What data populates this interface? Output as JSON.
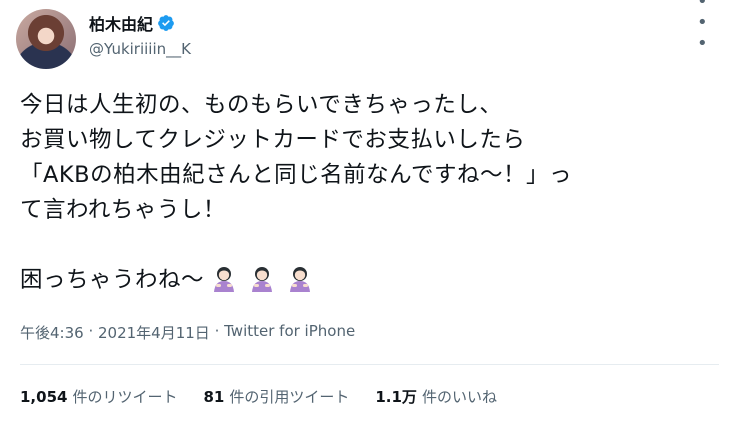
{
  "author": {
    "display_name": "柏木由紀",
    "handle": "@Yukiriiiin__K",
    "verified_color": "#1d9bf0"
  },
  "tweet": {
    "lines": [
      "今日は人生初の、ものもらいできちゃったし、",
      "お買い物してクレジットカードでお支払いしたら",
      "「AKBの柏木由紀さんと同じ名前なんですね〜！」っ",
      "て言われちゃうし！"
    ],
    "closing": "困っちゃうわね〜",
    "emoji": [
      "woman-bowing-emoji",
      "woman-bowing-emoji",
      "woman-bowing-emoji"
    ]
  },
  "meta": {
    "time": "午後4:36",
    "sep1": " · ",
    "date": "2021年4月11日",
    "sep2": " · ",
    "source": "Twitter for iPhone"
  },
  "stats": {
    "retweets_count": "1,054",
    "retweets_label": "件のリツイート",
    "quotes_count": "81",
    "quotes_label": "件の引用ツイート",
    "likes_count": "1.1万",
    "likes_label": "件のいいね"
  }
}
